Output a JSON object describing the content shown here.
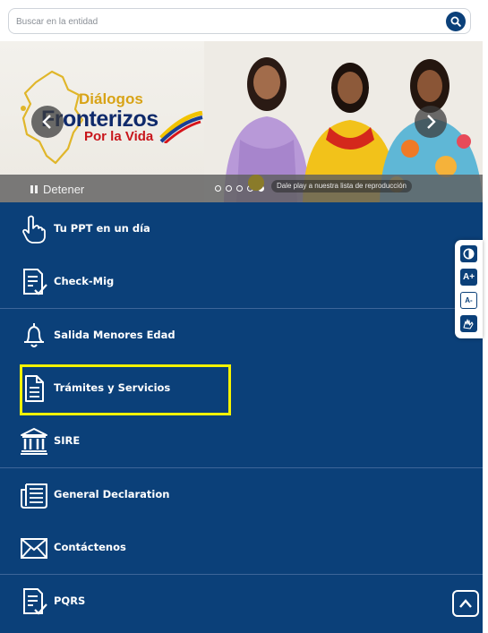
{
  "search": {
    "placeholder": "Buscar en la entidad"
  },
  "carousel": {
    "brand_line1": "Diálogos",
    "brand_line2": "Fronterizos",
    "brand_line3": "Por la Vida",
    "stop_label": "Detener",
    "play_note": "Dale play a nuestra lista de reproducción",
    "slide_count": 5,
    "active_slide": 5
  },
  "menu": {
    "items": [
      {
        "label": "Tu PPT en un día",
        "icon": "hand-pointer-icon"
      },
      {
        "label": "Check-Mig",
        "icon": "checklist-icon"
      },
      {
        "label": "Salida Menores Edad",
        "icon": "bell-icon"
      },
      {
        "label": "Trámites y Servicios",
        "icon": "document-icon"
      },
      {
        "label": "SIRE",
        "icon": "building-icon"
      },
      {
        "label": "General Declaration",
        "icon": "newspaper-icon"
      },
      {
        "label": "Contáctenos",
        "icon": "envelope-icon"
      },
      {
        "label": "PQRS",
        "icon": "checklist-icon"
      }
    ]
  },
  "accessibility": {
    "buttons": [
      "contrast-icon",
      "font-increase-icon",
      "font-decrease-icon",
      "sign-language-icon"
    ],
    "font_increase": "A+",
    "font_decrease": "A-"
  },
  "colors": {
    "primary": "#0b4079",
    "highlight": "#f3f200",
    "divider": "#3d6699"
  }
}
